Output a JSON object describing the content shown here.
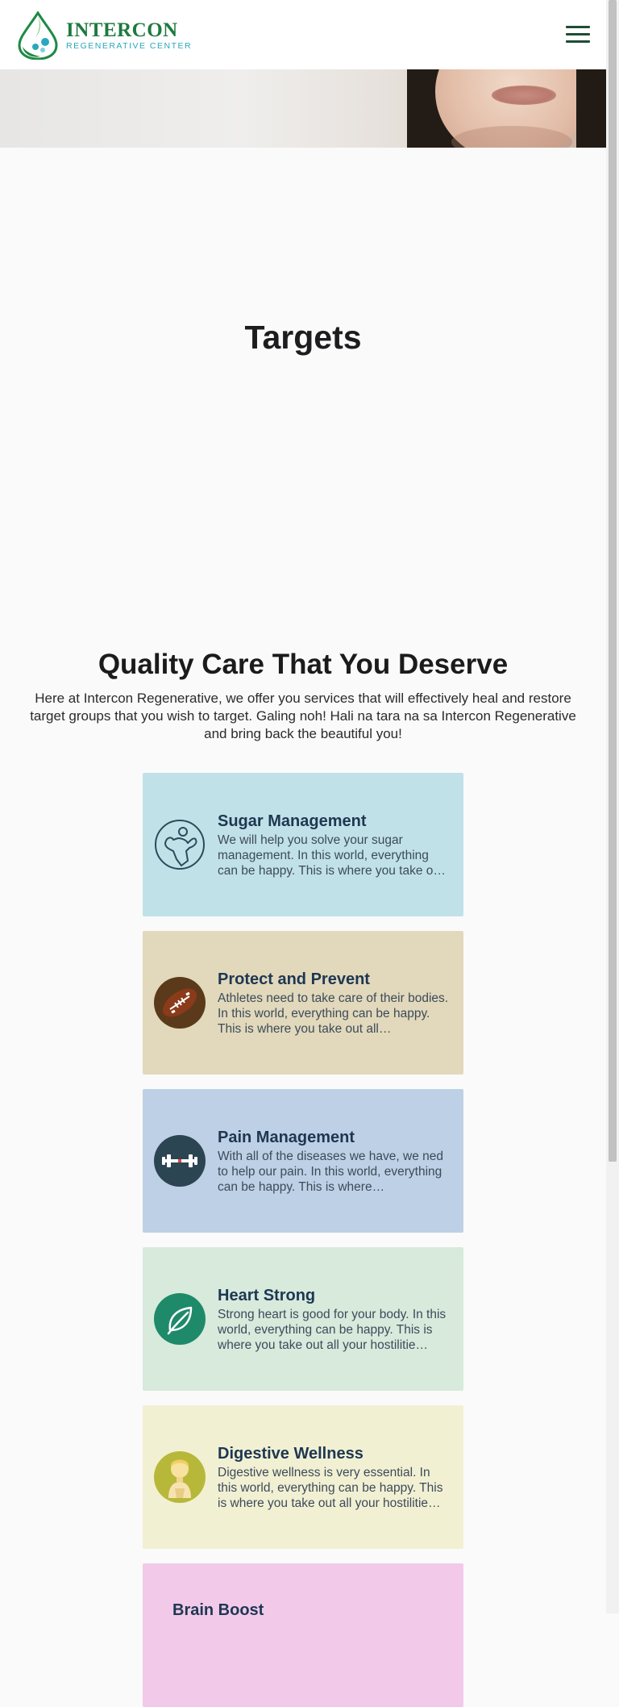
{
  "brand": {
    "name": "INTERCON",
    "tagline": "REGENERATIVE CENTER",
    "colors": {
      "primary": "#1e7a3f",
      "accent": "#2aa7bd"
    }
  },
  "header": {
    "menu_icon": "hamburger-menu-icon"
  },
  "page": {
    "title": "Targets"
  },
  "intro": {
    "heading": "Quality Care That You Deserve",
    "text": "Here at Intercon Regenerative, we offer you services that will effectively heal and restore target groups that you wish to target. Galing noh! Hali na tara na sa Intercon Regenerative and bring back the beautiful you!"
  },
  "services": [
    {
      "title": "Sugar Management",
      "description": "We will help you solve your sugar management. In this world, everything can be happy. This is where you take o…",
      "icon": "flexing-figure-icon",
      "color": "#c1e1e8"
    },
    {
      "title": "Protect and Prevent",
      "description": "Athletes need to take care of their bodies. In this world, everything can be happy. This is where you take out all…",
      "icon": "football-icon",
      "color": "#e2d8bb"
    },
    {
      "title": "Pain Management",
      "description": "With all of the diseases we have, we ned to help our pain. In this world, everything can be happy. This is where…",
      "icon": "dumbbell-icon",
      "color": "#bed0e5"
    },
    {
      "title": "Heart Strong",
      "description": "Strong heart is good for your body. In this world, everything can be happy. This is where you take out all your hostilitie…",
      "icon": "leaf-icon",
      "color": "#d7eadc"
    },
    {
      "title": "Digestive Wellness",
      "description": "Digestive wellness is very essential. In this world, everything can be happy. This is where you take out all your hostilitie…",
      "icon": "person-icon",
      "color": "#f2f0d3"
    },
    {
      "title": "Brain Boost",
      "color": "#f3c9e9"
    }
  ]
}
